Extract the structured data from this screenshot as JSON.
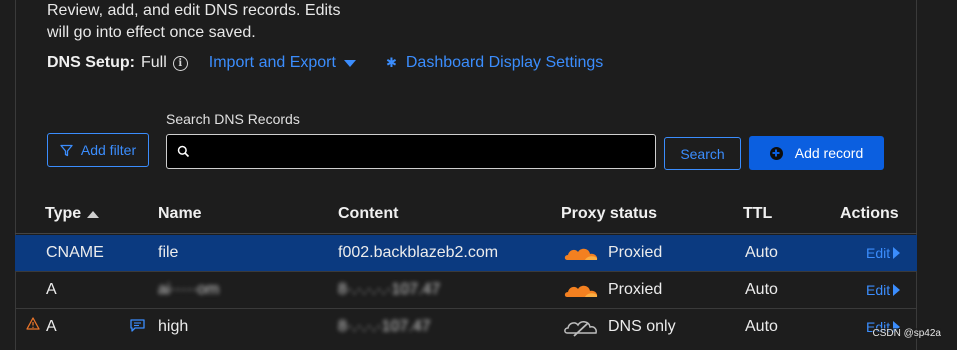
{
  "description_line1": "Review, add, and edit DNS records. Edits",
  "description_line2": "will go into effect once saved.",
  "dns_setup": {
    "label": "DNS Setup:",
    "value": "Full"
  },
  "links": {
    "import_export": "Import and Export",
    "dashboard_settings": "Dashboard Display Settings"
  },
  "search": {
    "label": "Search DNS Records",
    "placeholder": "",
    "value": ""
  },
  "buttons": {
    "add_filter": "Add filter",
    "search": "Search",
    "add_record": "Add record"
  },
  "table": {
    "headers": {
      "type": "Type",
      "name": "Name",
      "content": "Content",
      "proxy": "Proxy status",
      "ttl": "TTL",
      "actions": "Actions"
    },
    "rows": [
      {
        "type": "CNAME",
        "name": "file",
        "content": "f002.backblazeb2.com",
        "proxy": "Proxied",
        "ttl": "Auto",
        "action": "Edit"
      },
      {
        "type": "A",
        "name": "ai·····om",
        "content": "8·.·.·.·.·107.47",
        "proxy": "Proxied",
        "ttl": "Auto",
        "action": "Edit"
      },
      {
        "type": "A",
        "name": "high",
        "content": "8·.·.·.·107.47",
        "proxy": "DNS only",
        "ttl": "Auto",
        "action": "Edit"
      }
    ]
  },
  "watermark": "CSDN @sp42a",
  "colors": {
    "accent": "#3b8dfd",
    "primary_button": "#0b5fe0",
    "selected_row": "#0b3a80",
    "proxied_cloud": "#f38020",
    "dns_only_cloud": "#bdbdbd",
    "warning": "#e8742a"
  }
}
